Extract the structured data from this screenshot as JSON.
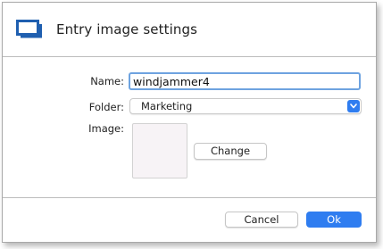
{
  "dialog": {
    "title": "Entry image settings",
    "header_icon": "window-icon"
  },
  "form": {
    "name_label": "Name:",
    "name_value": "windjammer4",
    "folder_label": "Folder:",
    "folder_value": "Marketing",
    "image_label": "Image:",
    "change_label": "Change"
  },
  "footer": {
    "cancel_label": "Cancel",
    "ok_label": "Ok"
  },
  "colors": {
    "accent": "#2f7df0",
    "focus_ring": "#6ea3e0",
    "icon_blue": "#1f5fb0"
  }
}
